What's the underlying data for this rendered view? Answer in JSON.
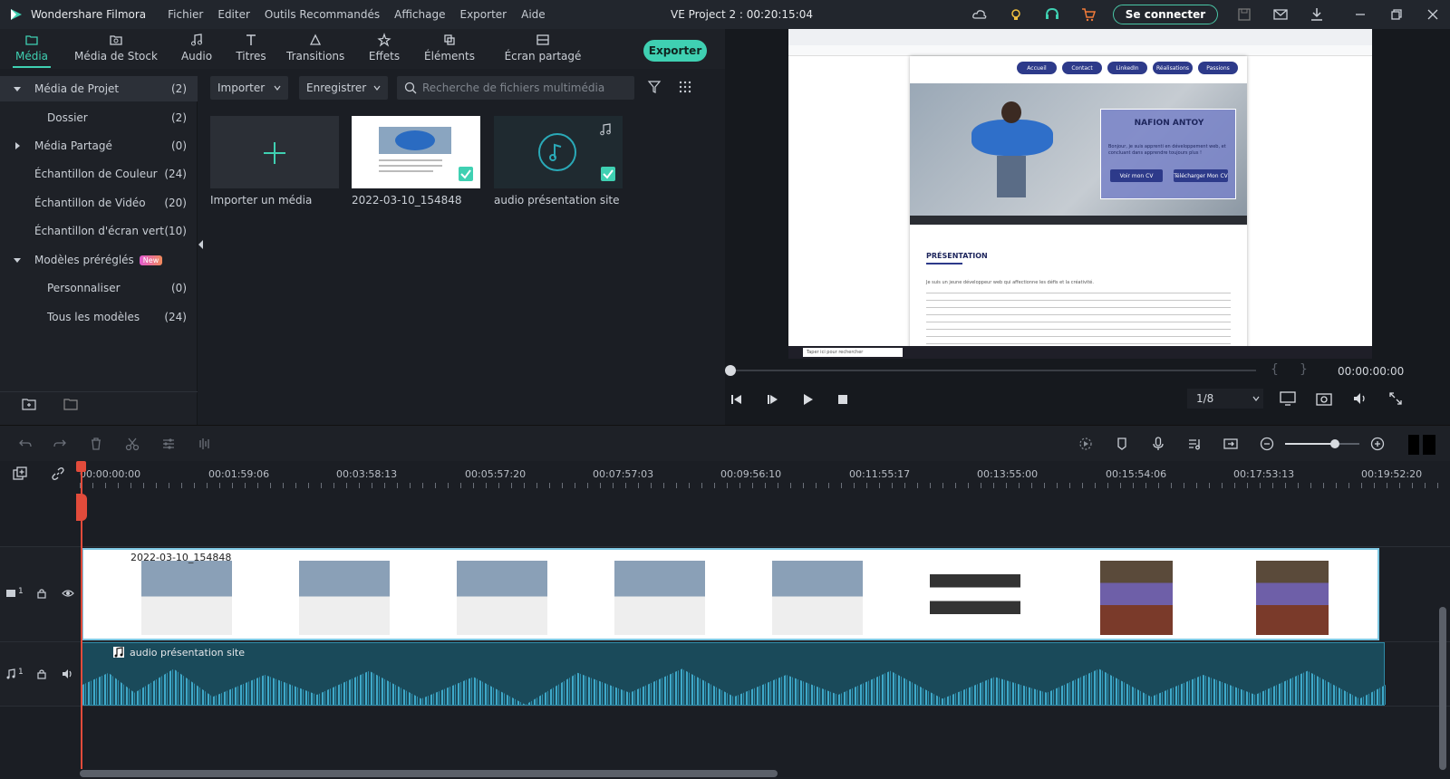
{
  "app": {
    "name": "Wondershare Filmora",
    "project_title": "VE Project 2 : 00:20:15:04",
    "connect_label": "Se connecter",
    "menu": [
      "Fichier",
      "Editer",
      "Outils Recommandés",
      "Affichage",
      "Exporter",
      "Aide"
    ],
    "toolbar_icons": [
      "cloud-icon",
      "bulb-icon",
      "headset-icon",
      "cart-icon",
      "save-icon",
      "mail-icon",
      "download-icon",
      "minimize-icon",
      "restore-icon",
      "close-icon"
    ],
    "accent_color": "#3fd0b2"
  },
  "tabs": [
    {
      "label": "Média",
      "icon": "folder-icon",
      "active": true
    },
    {
      "label": "Média de Stock",
      "icon": "image-folder-icon"
    },
    {
      "label": "Audio",
      "icon": "music-icon"
    },
    {
      "label": "Titres",
      "icon": "text-icon"
    },
    {
      "label": "Transitions",
      "icon": "transition-icon"
    },
    {
      "label": "Effets",
      "icon": "effects-icon"
    },
    {
      "label": "Éléments",
      "icon": "elements-icon"
    },
    {
      "label": "Écran partagé",
      "icon": "split-screen-icon"
    }
  ],
  "export_label": "Exporter",
  "sidebar": {
    "items": [
      {
        "label": "Média de Projet",
        "count": "(2)",
        "expanded": true
      },
      {
        "label": "Dossier",
        "count": "(2)"
      },
      {
        "label": "Média Partagé",
        "count": "(0)"
      },
      {
        "label": "Échantillon de Couleur",
        "count": "(24)"
      },
      {
        "label": "Échantillon de Vidéo",
        "count": "(20)"
      },
      {
        "label": "Échantillon d'écran vert",
        "count": "(10)"
      },
      {
        "label": "Modèles préréglés",
        "count": "",
        "badge": "New"
      },
      {
        "label": "Personnaliser",
        "count": "(0)"
      },
      {
        "label": "Tous les modèles",
        "count": "(24)"
      }
    ]
  },
  "media": {
    "import_label": "Importer",
    "record_label": "Enregistrer",
    "search_placeholder": "Recherche de fichiers multimédia",
    "items": [
      {
        "label": "Importer un média"
      },
      {
        "label": "2022-03-10_154848"
      },
      {
        "label": "audio présentation site"
      }
    ]
  },
  "preview": {
    "nav": [
      "Accueil",
      "Contact",
      "LinkedIn",
      "Réalisations",
      "Passions"
    ],
    "hero_name": "NAFION ANTOY",
    "hero_text": "Bonjour, je suis apprenti en développement web, et concluant dans apprendre toujours plus !",
    "hero_buttons": [
      "Voir mon CV",
      "Télécharger Mon CV"
    ],
    "section_title": "PRÉSENTATION",
    "body_text": "Je suis un jeune développeur web qui affectionne les défis et la créativité.",
    "timecode": "00:00:00:00",
    "quality": "1/8",
    "taskbar_search": "Taper ici pour rechercher"
  },
  "timeline": {
    "ruler_labels": [
      "00:00:00:00",
      "00:01:59:06",
      "00:03:58:13",
      "00:05:57:20",
      "00:07:57:03",
      "00:09:56:10",
      "00:11:55:17",
      "00:13:55:00",
      "00:15:54:06",
      "00:17:53:13",
      "00:19:52:20"
    ],
    "video_track": {
      "label": "1",
      "clip_label": "2022-03-10_154848"
    },
    "audio_track": {
      "label": "1",
      "clip_label": "audio présentation site"
    },
    "zoom_level": 0.67
  }
}
